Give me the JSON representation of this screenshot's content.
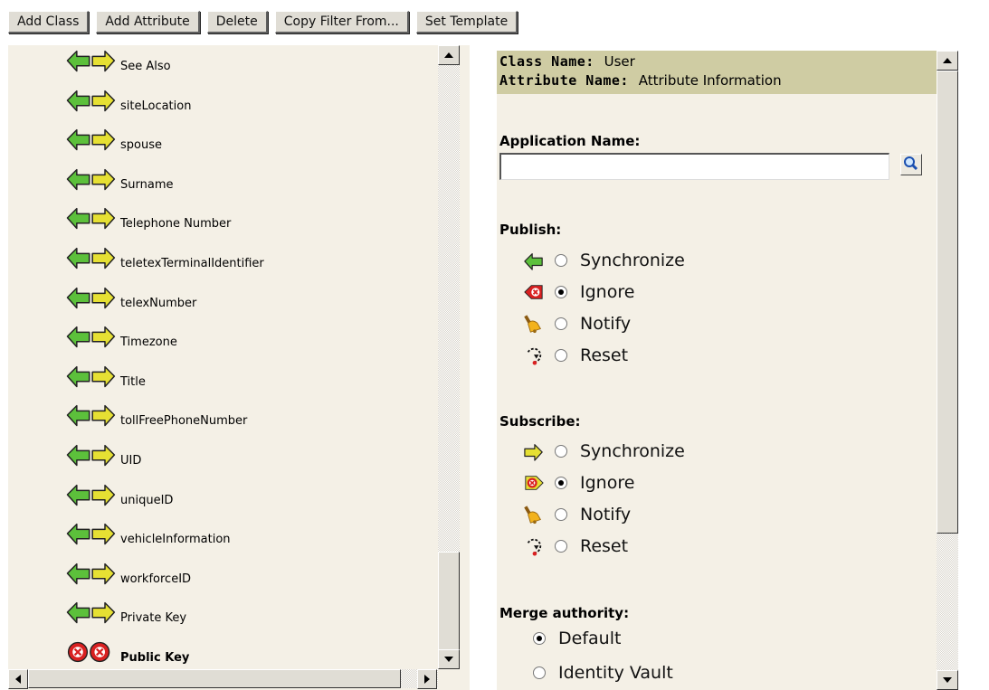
{
  "toolbar": {
    "add_class": "Add Class",
    "add_attribute": "Add Attribute",
    "delete": "Delete",
    "copy_filter": "Copy Filter From...",
    "set_template": "Set Template"
  },
  "attributes": [
    {
      "label": "See Also",
      "state": "sync"
    },
    {
      "label": "siteLocation",
      "state": "sync"
    },
    {
      "label": "spouse",
      "state": "sync"
    },
    {
      "label": "Surname",
      "state": "sync"
    },
    {
      "label": "Telephone Number",
      "state": "sync"
    },
    {
      "label": "teletexTerminalIdentifier",
      "state": "sync"
    },
    {
      "label": "telexNumber",
      "state": "sync"
    },
    {
      "label": "Timezone",
      "state": "sync"
    },
    {
      "label": "Title",
      "state": "sync"
    },
    {
      "label": "tollFreePhoneNumber",
      "state": "sync"
    },
    {
      "label": "UID",
      "state": "sync"
    },
    {
      "label": "uniqueID",
      "state": "sync"
    },
    {
      "label": "vehicleInformation",
      "state": "sync"
    },
    {
      "label": "workforceID",
      "state": "sync"
    },
    {
      "label": "Private Key",
      "state": "sync"
    },
    {
      "label": "Public Key",
      "state": "ignore",
      "selected": true
    }
  ],
  "header": {
    "class_key": "Class Name:",
    "class_value": "User",
    "attr_key": "Attribute Name:",
    "attr_value": "Attribute Information"
  },
  "application": {
    "label": "Application Name:",
    "value": ""
  },
  "publish": {
    "label": "Publish:",
    "options": [
      {
        "label": "Synchronize",
        "icon": "publish-sync-icon",
        "checked": false
      },
      {
        "label": "Ignore",
        "icon": "publish-ignore-icon",
        "checked": true
      },
      {
        "label": "Notify",
        "icon": "notify-bell-icon",
        "checked": false
      },
      {
        "label": "Reset",
        "icon": "reset-icon",
        "checked": false
      }
    ]
  },
  "subscribe": {
    "label": "Subscribe:",
    "options": [
      {
        "label": "Synchronize",
        "icon": "subscribe-sync-icon",
        "checked": false
      },
      {
        "label": "Ignore",
        "icon": "subscribe-ignore-icon",
        "checked": true
      },
      {
        "label": "Notify",
        "icon": "notify-bell-icon",
        "checked": false
      },
      {
        "label": "Reset",
        "icon": "reset-icon",
        "checked": false
      }
    ]
  },
  "merge": {
    "label": "Merge authority:",
    "options": [
      {
        "label": "Default",
        "checked": true
      },
      {
        "label": "Identity Vault",
        "checked": false
      }
    ]
  },
  "colors": {
    "panel_bg": "#f4f0e6",
    "header_bg": "#cfcca3",
    "button_face": "#e0ddd5",
    "arrow_green": "#3a9a2a",
    "arrow_yellow": "#e6e033",
    "ignore_red": "#d92020"
  }
}
